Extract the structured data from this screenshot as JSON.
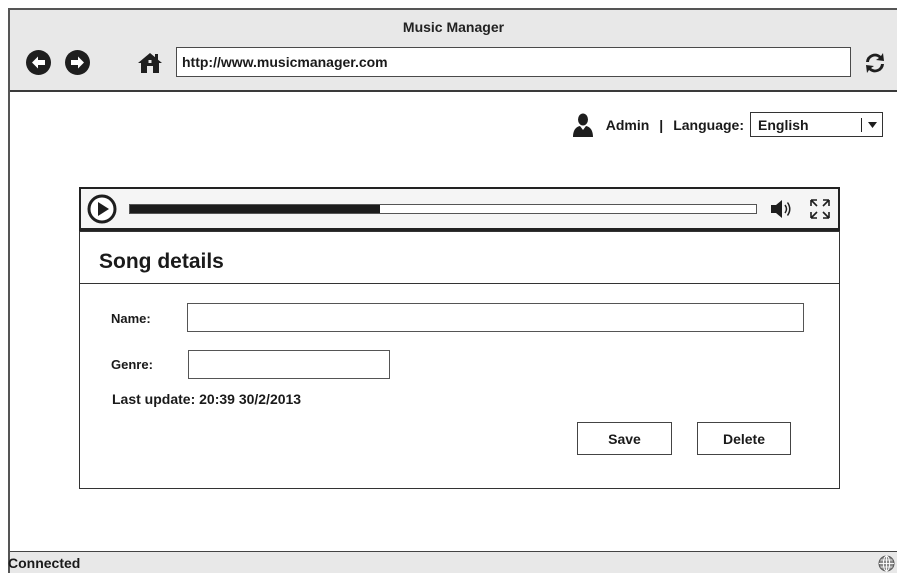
{
  "window": {
    "title": "Music Manager",
    "url": "http://www.musicmanager.com"
  },
  "icons": {
    "back": "back-arrow-icon",
    "forward": "forward-arrow-icon",
    "home": "home-icon",
    "reload": "reload-icon",
    "user": "user-icon",
    "play": "play-icon",
    "volume": "volume-icon",
    "fullscreen": "fullscreen-icon",
    "status": "globe-icon"
  },
  "userbar": {
    "user_name": "Admin",
    "separator": "|",
    "language_label": "Language:",
    "language_selected": "English"
  },
  "player": {
    "progress_fraction": 0.4
  },
  "song_details": {
    "title": "Song details",
    "name_label": "Name:",
    "name_value": "",
    "genre_label": "Genre:",
    "genre_value": "",
    "last_update": "Last update: 20:39 30/2/2013",
    "save_label": "Save",
    "delete_label": "Delete"
  },
  "status": {
    "text": "Connected"
  },
  "colors": {
    "chrome_background": "#e8e8e8",
    "ink": "#1a1a1a",
    "border": "#333333",
    "content_background": "#ffffff"
  }
}
